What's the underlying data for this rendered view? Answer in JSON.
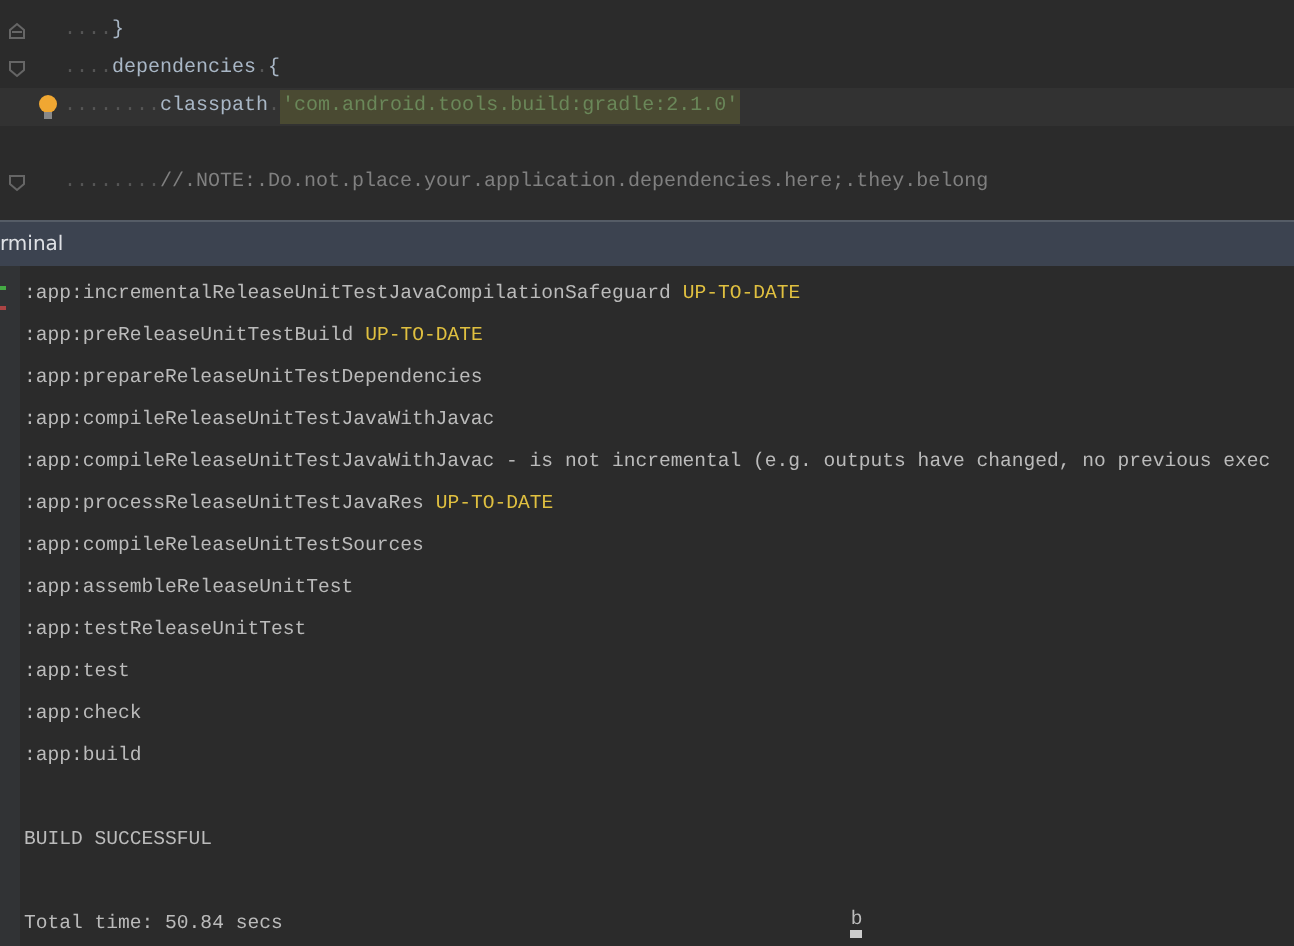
{
  "editor": {
    "lines": [
      {
        "kind": "closing",
        "bulb": false,
        "segments": [
          {
            "kind": "dots",
            "text": "...."
          },
          {
            "kind": "code",
            "text": "}"
          }
        ]
      },
      {
        "kind": "opening",
        "bulb": false,
        "segments": [
          {
            "kind": "dots",
            "text": "...."
          },
          {
            "kind": "code",
            "text": "dependencies"
          },
          {
            "kind": "dots",
            "text": "."
          },
          {
            "kind": "code",
            "text": "{"
          }
        ]
      },
      {
        "kind": "plain",
        "bulb": true,
        "segments": [
          {
            "kind": "dots",
            "text": "........"
          },
          {
            "kind": "code",
            "text": "classpath"
          },
          {
            "kind": "dots",
            "text": "."
          },
          {
            "kind": "string",
            "text": "'com.android.tools.build:gradle:2.1.0'"
          }
        ]
      },
      {
        "kind": "plain",
        "bulb": false
      },
      {
        "kind": "opening",
        "bulb": false,
        "segments": [
          {
            "kind": "dots",
            "text": "........"
          },
          {
            "kind": "comment",
            "text": "//.NOTE:.Do.not.place.your.application.dependencies.here;.they.belong"
          }
        ]
      }
    ]
  },
  "terminal": {
    "title": "rminal",
    "lines": [
      {
        "kind": "output",
        "text": ":app:incrementalReleaseUnitTestJavaCompilationSafeguard",
        "status": "UP-TO-DATE"
      },
      {
        "kind": "output",
        "text": ":app:preReleaseUnitTestBuild",
        "status": "UP-TO-DATE"
      },
      {
        "kind": "output",
        "text": ":app:prepareReleaseUnitTestDependencies"
      },
      {
        "kind": "output",
        "text": ":app:compileReleaseUnitTestJavaWithJavac"
      },
      {
        "kind": "output",
        "text": ":app:compileReleaseUnitTestJavaWithJavac - is not incremental (e.g. outputs have changed, no previous exec"
      },
      {
        "kind": "output",
        "text": ":app:processReleaseUnitTestJavaRes",
        "status": "UP-TO-DATE"
      },
      {
        "kind": "output",
        "text": ":app:compileReleaseUnitTestSources"
      },
      {
        "kind": "output",
        "text": ":app:assembleReleaseUnitTest"
      },
      {
        "kind": "output",
        "text": ":app:testReleaseUnitTest"
      },
      {
        "kind": "output",
        "text": ":app:test"
      },
      {
        "kind": "output",
        "text": ":app:check"
      },
      {
        "kind": "output",
        "text": ":app:build"
      },
      {
        "kind": "blank"
      },
      {
        "kind": "output",
        "text": "BUILD SUCCESSFUL"
      },
      {
        "kind": "blank"
      },
      {
        "kind": "output",
        "text": "Total time: 50.84 secs",
        "input": "b"
      }
    ]
  }
}
